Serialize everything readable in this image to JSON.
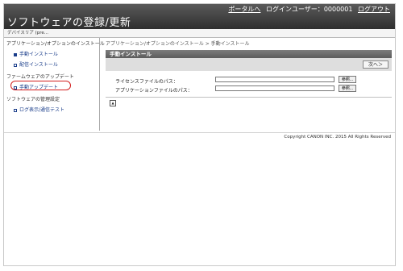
{
  "header": {
    "title": "ソフトウェアの登録/更新",
    "portal_link": "ポータルへ",
    "login_label": "ログインユーザー：",
    "login_user": "0000001",
    "logout_link": "ログアウト"
  },
  "device_bar": {
    "label": "デバイスリア (pre..."
  },
  "sidebar": {
    "sections": [
      {
        "title": "アプリケーション/オプションのインストール",
        "items": [
          {
            "label": "手動インストール",
            "active": true
          },
          {
            "label": "配信インストール",
            "active": false
          }
        ]
      },
      {
        "title": "ファームウェアのアップデート",
        "items": [
          {
            "label": "手動アップデート",
            "active": false
          }
        ]
      },
      {
        "title": "ソフトウェアの管理設定",
        "items": [
          {
            "label": "ログ表示/通信テスト",
            "active": false
          }
        ]
      }
    ]
  },
  "main": {
    "breadcrumb": "アプリケーション/オプションのインストール > 手動インストール",
    "section_title": "手動インストール",
    "next_button": "次へ＞",
    "license_label": "ライセンスファイルのパス：",
    "app_label": "アプリケーションファイルのパス：",
    "browse_button": "参照...",
    "top_icon": "▲"
  },
  "footer": {
    "copyright": "Copyright CANON INC. 2015 All Rights Reserved"
  },
  "colors": {
    "highlight_circle": "#d21f1f",
    "header_bg": "#3a3a3a",
    "link": "#1a3d8a"
  }
}
